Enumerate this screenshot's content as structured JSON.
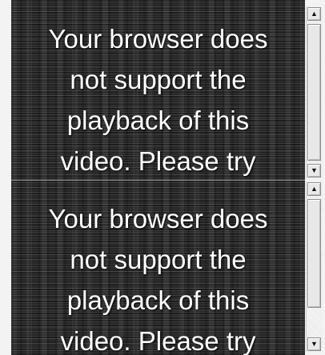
{
  "players": [
    {
      "message": "Your browser does not support the playback of this video. Please try",
      "lines": [
        "Your browser does",
        "not support the",
        "playback of this",
        "video. Please try"
      ]
    },
    {
      "message": "Your browser does not support the playback of this video. Please try",
      "lines": [
        "Your browser does",
        "not support the",
        "playback of this",
        "video. Please try"
      ]
    }
  ],
  "scrollbars": [
    {
      "up_icon": "▲",
      "down_icon": "▼"
    },
    {
      "up_icon": "▲",
      "down_icon": "▼"
    }
  ]
}
